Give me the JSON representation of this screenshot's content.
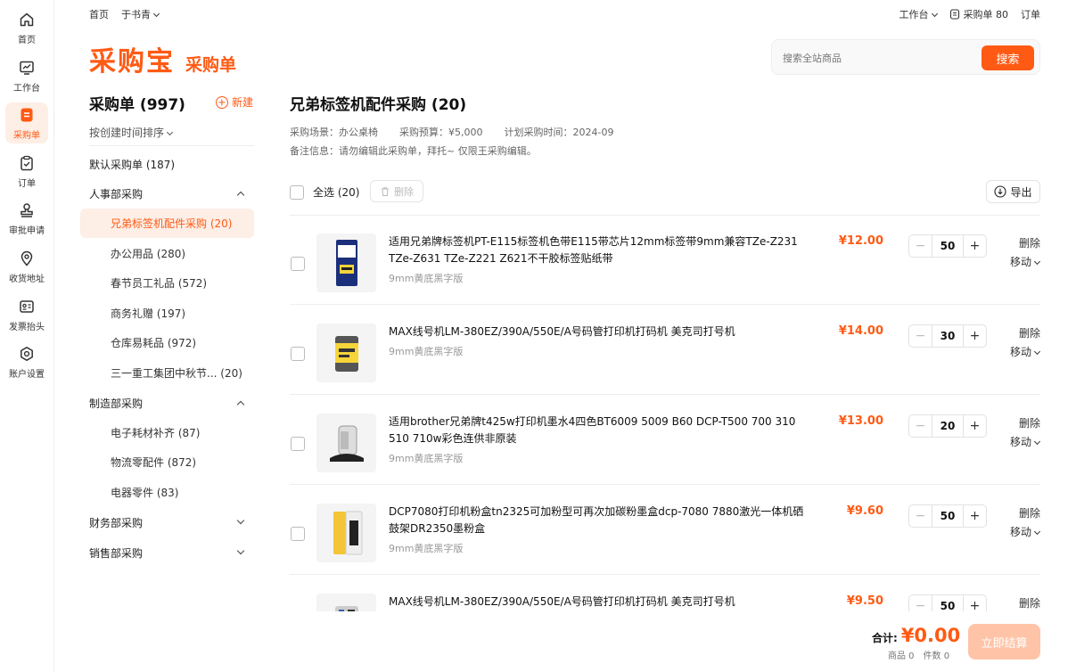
{
  "nav": {
    "items": [
      {
        "label": "首页",
        "icon": "home-icon"
      },
      {
        "label": "工作台",
        "icon": "dashboard-icon"
      },
      {
        "label": "采购单",
        "icon": "order-list-icon",
        "active": true
      },
      {
        "label": "订单",
        "icon": "clipboard-icon"
      },
      {
        "label": "审批申请",
        "icon": "stamp-icon"
      },
      {
        "label": "收货地址",
        "icon": "location-icon"
      },
      {
        "label": "发票抬头",
        "icon": "invoice-icon"
      },
      {
        "label": "账户设置",
        "icon": "gear-icon"
      }
    ]
  },
  "topbar": {
    "home": "首页",
    "user": "于书青",
    "workbench": "工作台",
    "cart": "采购单 80",
    "orders": "订单"
  },
  "brand": {
    "name": "采购宝",
    "section": "采购单"
  },
  "search": {
    "placeholder": "搜索全站商品",
    "button": "搜索"
  },
  "sidebar": {
    "title": "采购单 (997)",
    "new_label": "新建",
    "sort_label": "按创建时间排序",
    "groups": [
      {
        "label": "默认采购单 (187)"
      },
      {
        "label": "人事部采购",
        "expanded": true
      },
      {
        "label": "制造部采购",
        "expanded": true
      },
      {
        "label": "财务部采购",
        "expanded": false
      },
      {
        "label": "销售部采购",
        "expanded": false
      }
    ],
    "hr_items": [
      {
        "label": "兄弟标签机配件采购 (20)",
        "active": true
      },
      {
        "label": "办公用品 (280)"
      },
      {
        "label": "春节员工礼品 (572)"
      },
      {
        "label": "商务礼赠 (197)"
      },
      {
        "label": "仓库易耗品 (972)"
      },
      {
        "label": "三一重工集团中秋节... (20)"
      }
    ],
    "mfg_items": [
      {
        "label": "电子耗材补齐 (87)"
      },
      {
        "label": "物流零配件 (872)"
      },
      {
        "label": "电器零件 (83)"
      }
    ]
  },
  "main": {
    "title": "兄弟标签机配件采购 (20)",
    "scene": "采购场景：办公桌椅",
    "budget": "采购预算：¥5,000",
    "plan_time": "计划采购时间：2024-09",
    "note": "备注信息：请勿编辑此采购单，拜托~ 仅限王采购编辑。",
    "select_all": "全选 (20)",
    "delete": "删除",
    "export": "导出",
    "delete_action": "删除",
    "move_action": "移动",
    "products": [
      {
        "title": "适用兄弟牌标签机PT-E115标签机色带E115带芯片12mm标签带9mm兼容TZe-Z231 TZe-Z631 TZe-Z221 Z621不干胶标签贴纸带",
        "spec": "9mm黄底黑字版",
        "price": "¥12.00",
        "qty": "50"
      },
      {
        "title": "MAX线号机LM-380EZ/390A/550E/A号码管打印机打码机 美克司打号机",
        "spec": "9mm黄底黑字版",
        "price": "¥14.00",
        "qty": "30"
      },
      {
        "title": "适用brother兄弟牌t425w打印机墨水4四色BT6009 5009 B60 DCP-T500 700 310 510 710w彩色连供非原装",
        "spec": "9mm黄底黑字版",
        "price": "¥13.00",
        "qty": "20"
      },
      {
        "title": "DCP7080打印机粉盒tn2325可加粉型可再次加碳粉墨盒dcp-7080 7880激光一体机硒鼓架DR2350墨粉盒",
        "spec": "9mm黄底黑字版",
        "price": "¥9.60",
        "qty": "50"
      },
      {
        "title": "MAX线号机LM-380EZ/390A/550E/A号码管打印机打码机 美克司打号机",
        "spec": "",
        "price": "¥9.50",
        "qty": "50"
      }
    ]
  },
  "footer": {
    "total_label": "合计:",
    "total_value": "¥0.00",
    "goods": "商品 0",
    "pieces": "件数 0",
    "checkout": "立即结算"
  },
  "colors": {
    "accent": "#ff5a14",
    "accent_light": "#fdeee6",
    "checkout_disabled": "#ffc4a8"
  }
}
